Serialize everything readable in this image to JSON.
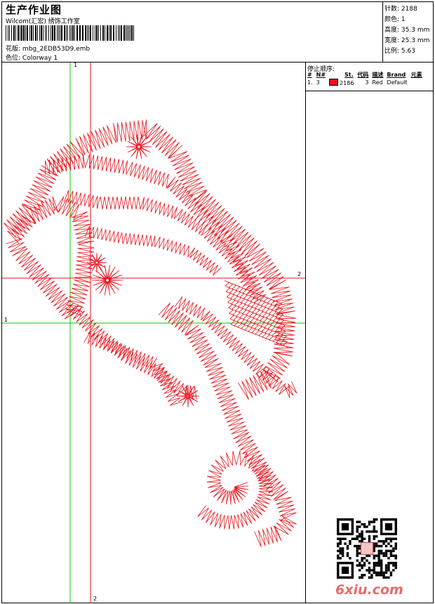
{
  "header": {
    "title": "生产作业图",
    "subtitle": "Wilcom(汇宏) 绣饰工作室",
    "design_label": "花版:",
    "design_value": "mbg_2EDB53D9.emb",
    "colorway_label": "色位:",
    "colorway_value": "Colorway 1"
  },
  "stats": [
    {
      "label": "针数:",
      "value": "2188"
    },
    {
      "label": "颜色:",
      "value": "1"
    },
    {
      "label": "高度:",
      "value": "35.3 mm"
    },
    {
      "label": "宽度:",
      "value": "25.3 mm"
    },
    {
      "label": "比例:",
      "value": "5.63"
    }
  ],
  "stop_sequence": {
    "heading": "停止顺序:",
    "columns": [
      "#",
      "N#",
      "St.",
      "代码",
      "描述",
      "Brand",
      "元素"
    ],
    "rows": [
      {
        "num": "1.",
        "needle": "3",
        "stitches": "2186",
        "code": "3",
        "desc": "Red",
        "brand": "Default",
        "swatch_color": "#e8121b"
      }
    ]
  },
  "axis_labels": {
    "v1_top": "1",
    "v2_bottom": "2",
    "h1_left": "1",
    "h2_right": "2"
  },
  "colors": {
    "thread": "#e8121b",
    "guide_green": "#00cc00",
    "guide_red": "#e8121b"
  },
  "watermark": "6xiu.com"
}
